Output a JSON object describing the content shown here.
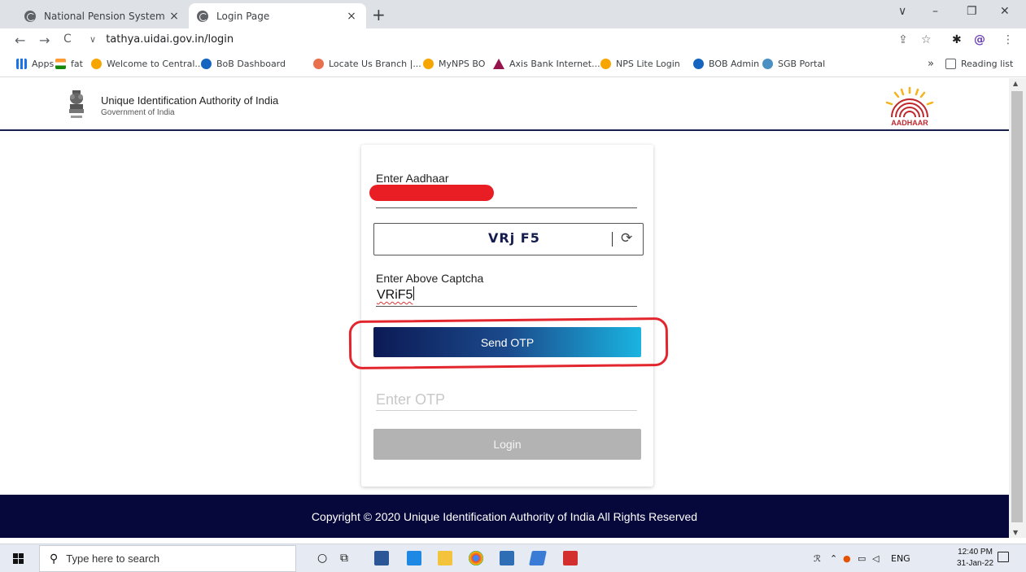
{
  "browser": {
    "tabs": [
      {
        "title": "National Pension System",
        "close": "×"
      },
      {
        "title": "Login Page",
        "close": "×"
      }
    ],
    "new_tab": "+",
    "window_controls": {
      "menu": "∨",
      "minimize": "–",
      "restore": "❐",
      "close": "✕"
    },
    "nav": {
      "back": "←",
      "forward": "→",
      "reload": "C"
    },
    "url": "tathya.uidai.gov.in/login",
    "toolbar_icons": {
      "share": "⇪",
      "star": "☆",
      "extensions": "✱",
      "profile": "@",
      "menu": "⋮"
    },
    "bookmarks": [
      {
        "label": "Apps",
        "icon": "apps-grid-icon"
      },
      {
        "label": "fat",
        "icon": "india-flag-icon"
      },
      {
        "label": "Welcome to Central...",
        "icon": "nps-icon"
      },
      {
        "label": "BoB Dashboard",
        "icon": "bob-icon"
      },
      {
        "label": "Locate Us Branch |...",
        "icon": "locate-icon"
      },
      {
        "label": "MyNPS BO",
        "icon": "nps-icon"
      },
      {
        "label": "Axis Bank Internet...",
        "icon": "axis-icon"
      },
      {
        "label": "NPS Lite Login",
        "icon": "nps-icon"
      },
      {
        "label": "BOB Admin",
        "icon": "bob-icon"
      },
      {
        "label": "SGB Portal",
        "icon": "sgb-icon"
      }
    ],
    "more_bookmarks": "»",
    "reading_list": "Reading list"
  },
  "header": {
    "org_name": "Unique Identification Authority of India",
    "org_sub": "Government of India",
    "emblem_caption": "सत्यमेव जयते",
    "logo_text": "AADHAAR"
  },
  "form": {
    "aadhaar_label": "Enter Aadhaar",
    "captcha_image_text": "VRj F5",
    "captcha_label": "Enter Above Captcha",
    "captcha_value": "VRiF5",
    "send_otp_label": "Send OTP",
    "otp_placeholder": "Enter OTP",
    "login_label": "Login"
  },
  "footer": {
    "text": "Copyright © 2020 Unique Identification Authority of India All Rights Reserved"
  },
  "taskbar": {
    "search_placeholder": "Type here to search",
    "tray_lang": "ENG",
    "time": "12:40 PM",
    "date": "31-Jan-22"
  },
  "colors": {
    "footer_bg": "#06073b",
    "send_otp_gradient_start": "#0c1a55",
    "send_otp_gradient_end": "#1ab4e0",
    "login_disabled": "#b3b3b3",
    "highlight_red": "#e3262e",
    "aadhaar_logo_red": "#c0282d",
    "aadhaar_logo_yellow": "#f6b21b"
  }
}
